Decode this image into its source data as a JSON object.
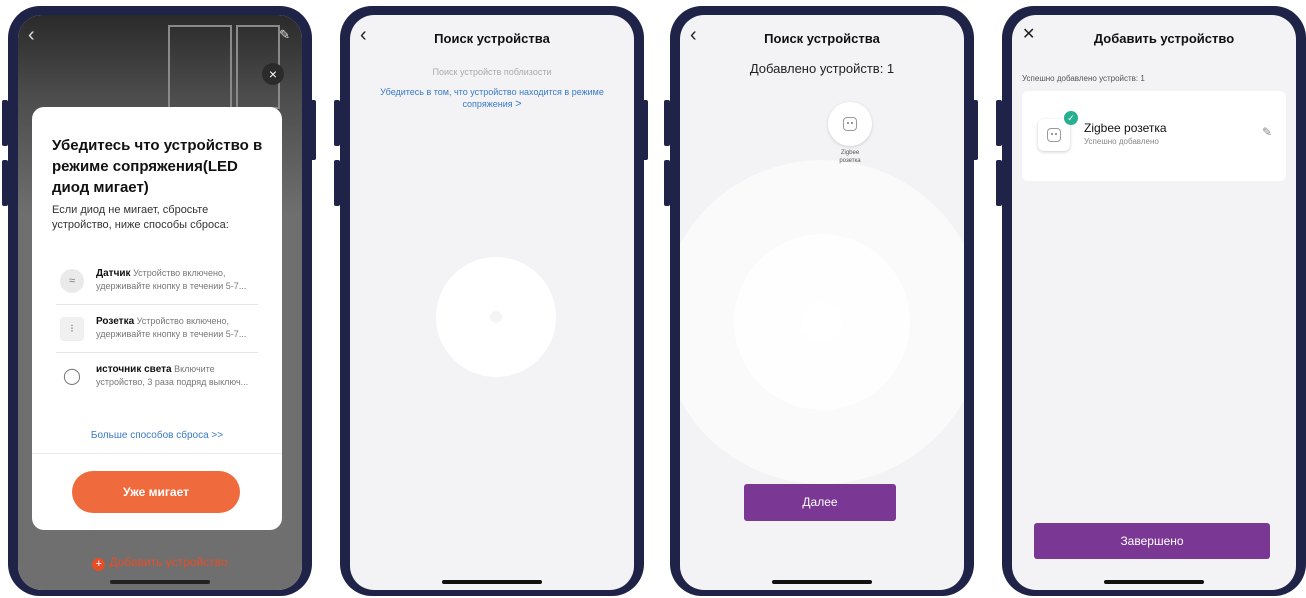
{
  "phone1": {
    "modal": {
      "title": "Убедитесь что устройство в режиме сопряжения(LED диод мигает)",
      "text": "Если диод не мигает, сбросьте устройство, ниже способы сброса:",
      "items": [
        {
          "icon": "sensor-icon",
          "name": "Датчик",
          "desc": "Устройство включено, удерживайте кнопку в течении 5-7..."
        },
        {
          "icon": "socket-icon",
          "name": "Розетка",
          "desc": "Устройство включено, удерживайте кнопку в течении 5-7..."
        },
        {
          "icon": "bulb-icon",
          "name": "источник света",
          "desc": "Включите устройство, 3 раза подряд выключ..."
        }
      ],
      "more_link": "Больше способов сброса >>",
      "button": "Уже мигает"
    },
    "add_device": "Добавить устройство"
  },
  "phone2": {
    "title": "Поиск устройства",
    "subtitle": "Поиск устройств поблизости",
    "hint": "Убедитесь в том, что устройство находится в режиме сопряжения",
    "hint_arrow": ">"
  },
  "phone3": {
    "title": "Поиск устройства",
    "added_count": "Добавлено устройств: 1",
    "device_label_1": "Zigbee",
    "device_label_2": "розетка",
    "button": "Далее"
  },
  "phone4": {
    "title": "Добавить устройство",
    "section_label": "Успешно добавлено устройств: 1",
    "device_name": "Zigbee розетка",
    "device_status": "Успешно добавлено",
    "button": "Завершено"
  },
  "colors": {
    "frame": "#1f2347",
    "orange": "#ef6a3c",
    "purple": "#7b3794",
    "link_blue": "#3a79c8",
    "success_green": "#26b08f"
  }
}
